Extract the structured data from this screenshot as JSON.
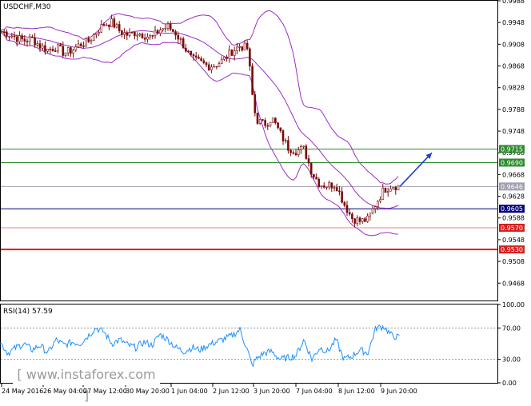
{
  "instrument_label": "USDCHF,M30",
  "rsi_label": "RSI(14) 57.59",
  "watermark": "[ www.instaforex.com ]",
  "colors": {
    "background": "#ffffff",
    "frame": "#000000",
    "candles": "#7a0a0a",
    "bollinger": "#9b2ec2",
    "rsi_line": "#1e90ff",
    "support_resistance_green": "#2e8b2e",
    "current_price": "#a0a0b0",
    "pivot_navy": "#000080",
    "support_red": "#d62020",
    "support_light_red": "#f08080",
    "arrow": "#1a3fd6",
    "watermark_bg": "#e03030"
  },
  "chart_data": [
    {
      "type": "candlestick",
      "title": "USDCHF,M30",
      "ylim": [
        0.9436,
        0.9988
      ],
      "y_ticks": [
        "0.9988",
        "0.9948",
        "0.9908",
        "0.9868",
        "0.9828",
        "0.9788",
        "0.9748",
        "0.9708",
        "0.9668",
        "0.9628",
        "0.9588",
        "0.9548",
        "0.9508",
        "0.9468"
      ],
      "x_tick_labels": [
        "24 May 2016",
        "26 May 04:00",
        "27 May 12:00",
        "30 May 20:00",
        "1 Jun 04:00",
        "2 Jun 12:00",
        "3 Jun 20:00",
        "7 Jun 04:00",
        "8 Jun 12:00",
        "9 Jun 20:00"
      ],
      "indicators": [
        "Bollinger Bands"
      ],
      "price_path": [
        [
          0,
          0.9932
        ],
        [
          10,
          0.9928
        ],
        [
          20,
          0.992
        ],
        [
          30,
          0.9915
        ],
        [
          40,
          0.9918
        ],
        [
          50,
          0.9905
        ],
        [
          60,
          0.9898
        ],
        [
          70,
          0.9903
        ],
        [
          80,
          0.9892
        ],
        [
          90,
          0.9897
        ],
        [
          100,
          0.9908
        ],
        [
          110,
          0.9912
        ],
        [
          120,
          0.993
        ],
        [
          130,
          0.9945
        ],
        [
          140,
          0.9948
        ],
        [
          150,
          0.9932
        ],
        [
          160,
          0.9925
        ],
        [
          170,
          0.993
        ],
        [
          180,
          0.9925
        ],
        [
          190,
          0.992
        ],
        [
          200,
          0.9935
        ],
        [
          210,
          0.994
        ],
        [
          220,
          0.9928
        ],
        [
          230,
          0.9905
        ],
        [
          240,
          0.988
        ],
        [
          250,
          0.9875
        ],
        [
          260,
          0.9868
        ],
        [
          270,
          0.987
        ],
        [
          280,
          0.988
        ],
        [
          290,
          0.9895
        ],
        [
          300,
          0.9905
        ],
        [
          310,
          0.99
        ],
        [
          315,
          0.982
        ],
        [
          320,
          0.977
        ],
        [
          330,
          0.976
        ],
        [
          340,
          0.9772
        ],
        [
          350,
          0.9745
        ],
        [
          360,
          0.9718
        ],
        [
          370,
          0.9712
        ],
        [
          380,
          0.9715
        ],
        [
          390,
          0.9672
        ],
        [
          400,
          0.965
        ],
        [
          410,
          0.9648
        ],
        [
          420,
          0.965
        ],
        [
          430,
          0.9615
        ],
        [
          440,
          0.9588
        ],
        [
          450,
          0.9582
        ],
        [
          460,
          0.9585
        ],
        [
          470,
          0.9615
        ],
        [
          480,
          0.964
        ],
        [
          490,
          0.9648
        ],
        [
          500,
          0.9646
        ]
      ],
      "horizontal_levels": [
        {
          "label": "0.9715",
          "value": 0.9715,
          "role": "resistance"
        },
        {
          "label": "0.9690",
          "value": 0.969,
          "role": "resistance"
        },
        {
          "label": "0.9646",
          "value": 0.9646,
          "role": "current"
        },
        {
          "label": "0.9605",
          "value": 0.9605,
          "role": "pivot"
        },
        {
          "label": "0.9570",
          "value": 0.957,
          "role": "support"
        },
        {
          "label": "0.9530",
          "value": 0.953,
          "role": "support"
        }
      ],
      "projection_arrow": {
        "from": [
          500,
          0.9646
        ],
        "to": [
          540,
          0.9708
        ]
      }
    },
    {
      "type": "line",
      "title": "RSI(14) 57.59",
      "ylim": [
        0,
        100
      ],
      "y_ticks": [
        "100.00",
        "70.00",
        "30.00",
        "0.00"
      ],
      "reference_levels": [
        70,
        30
      ],
      "series": [
        {
          "values": [
            [
              0,
              52
            ],
            [
              10,
              38
            ],
            [
              20,
              45
            ],
            [
              30,
              50
            ],
            [
              40,
              42
            ],
            [
              50,
              48
            ],
            [
              60,
              38
            ],
            [
              70,
              55
            ],
            [
              80,
              48
            ],
            [
              90,
              52
            ],
            [
              100,
              50
            ],
            [
              110,
              60
            ],
            [
              120,
              70
            ],
            [
              130,
              65
            ],
            [
              140,
              50
            ],
            [
              150,
              55
            ],
            [
              160,
              48
            ],
            [
              170,
              45
            ],
            [
              180,
              52
            ],
            [
              190,
              48
            ],
            [
              200,
              62
            ],
            [
              210,
              55
            ],
            [
              220,
              45
            ],
            [
              230,
              40
            ],
            [
              240,
              45
            ],
            [
              250,
              42
            ],
            [
              260,
              48
            ],
            [
              270,
              52
            ],
            [
              280,
              56
            ],
            [
              290,
              60
            ],
            [
              300,
              68
            ],
            [
              310,
              40
            ],
            [
              315,
              22
            ],
            [
              320,
              30
            ],
            [
              330,
              38
            ],
            [
              340,
              40
            ],
            [
              350,
              30
            ],
            [
              360,
              32
            ],
            [
              370,
              35
            ],
            [
              380,
              55
            ],
            [
              390,
              30
            ],
            [
              400,
              45
            ],
            [
              410,
              40
            ],
            [
              420,
              55
            ],
            [
              430,
              30
            ],
            [
              440,
              34
            ],
            [
              450,
              42
            ],
            [
              460,
              38
            ],
            [
              470,
              70
            ],
            [
              480,
              72
            ],
            [
              490,
              60
            ],
            [
              500,
              57.59
            ]
          ]
        }
      ]
    }
  ]
}
